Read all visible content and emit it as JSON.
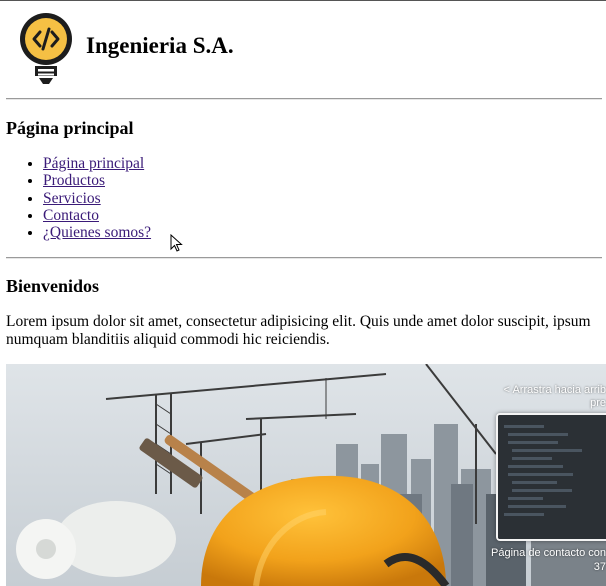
{
  "site": {
    "title": "Ingenieria S.A.",
    "logo_icon": "lightbulb-code-icon"
  },
  "nav": {
    "heading": "Página principal",
    "items": [
      {
        "label": "Página principal"
      },
      {
        "label": "Productos"
      },
      {
        "label": "Servicios"
      },
      {
        "label": "Contacto"
      },
      {
        "label": "¿Quienes somos?"
      }
    ]
  },
  "welcome": {
    "heading": "Bienvenidos",
    "text": "Lorem ipsum dolor sit amet, consectetur adipisicing elit. Quis unde amet dolor suscipit, ipsum numquam blanditiis aliquid commodi hic reiciendis."
  },
  "overlay": {
    "hint_line1": "< Arrastra hacia arrib",
    "hint_line2": "pre",
    "caption_line1": "Página de contacto con",
    "caption_line2": "37"
  },
  "colors": {
    "link": "#3a1a78",
    "helmet": "#f2a21b",
    "logo_fill": "#f5c044"
  }
}
